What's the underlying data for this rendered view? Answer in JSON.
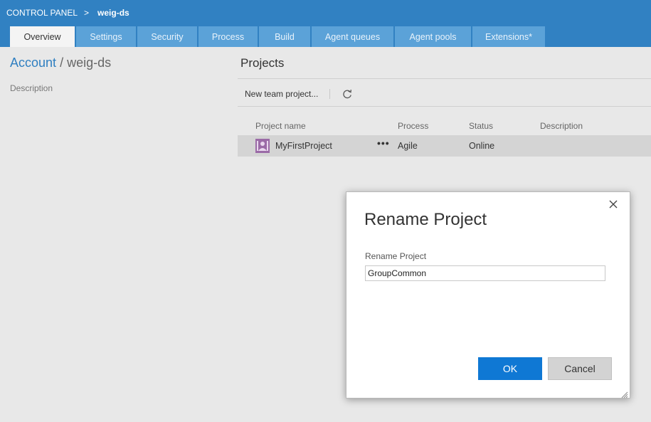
{
  "breadcrumb": {
    "root": "CONTROL PANEL",
    "separator": ">",
    "current": "weig-ds"
  },
  "tabs": [
    {
      "label": "Overview",
      "active": true
    },
    {
      "label": "Settings",
      "active": false
    },
    {
      "label": "Security",
      "active": false
    },
    {
      "label": "Process",
      "active": false
    },
    {
      "label": "Build",
      "active": false
    },
    {
      "label": "Agent queues",
      "active": false
    },
    {
      "label": "Agent pools",
      "active": false
    },
    {
      "label": "Extensions*",
      "active": false
    }
  ],
  "account": {
    "link": "Account",
    "separator": "/",
    "name": "weig-ds",
    "description_label": "Description"
  },
  "projects": {
    "title": "Projects",
    "new_button": "New team project...",
    "refresh_icon": "refresh-icon",
    "columns": {
      "name": "Project name",
      "process": "Process",
      "status": "Status",
      "description": "Description"
    },
    "rows": [
      {
        "name": "MyFirstProject",
        "menu": "•••",
        "process": "Agile",
        "status": "Online",
        "description": ""
      }
    ]
  },
  "dialog": {
    "title": "Rename Project",
    "field_label": "Rename Project",
    "field_value": "GroupCommon",
    "ok_label": "OK",
    "cancel_label": "Cancel"
  },
  "colors": {
    "header": "#3181c2",
    "tab": "#5ba2d8",
    "link": "#2f7fc1",
    "primary_button": "#0f78d4",
    "project_icon": "#9b6ba7"
  }
}
